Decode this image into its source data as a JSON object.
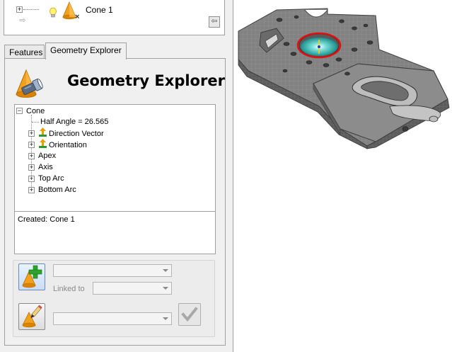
{
  "top_tree": {
    "item_label": "Cone 1"
  },
  "tabs": [
    {
      "label": "Features"
    },
    {
      "label": "Geometry Explorer"
    }
  ],
  "panel": {
    "title": "Geometry Explorer"
  },
  "tree": {
    "root": "Cone",
    "children": [
      {
        "label": "Half Angle = 26.565",
        "expandable": false
      },
      {
        "label": "Direction Vector",
        "expandable": true,
        "icon": "vector-icon"
      },
      {
        "label": "Orientation",
        "expandable": true,
        "icon": "vector-icon"
      },
      {
        "label": "Apex",
        "expandable": true
      },
      {
        "label": "Axis",
        "expandable": true
      },
      {
        "label": "Top Arc",
        "expandable": true
      },
      {
        "label": "Bottom Arc",
        "expandable": true
      }
    ]
  },
  "info": {
    "text": "Created: Cone 1"
  },
  "controls": {
    "combo_1_value": "",
    "linked_label": "Linked to",
    "linked_value": "",
    "combo_2_value": ""
  },
  "colors": {
    "selection_highlight": "#e01010",
    "cone_face": "#2fb8b0",
    "part_gray": "#7a7a7a"
  }
}
